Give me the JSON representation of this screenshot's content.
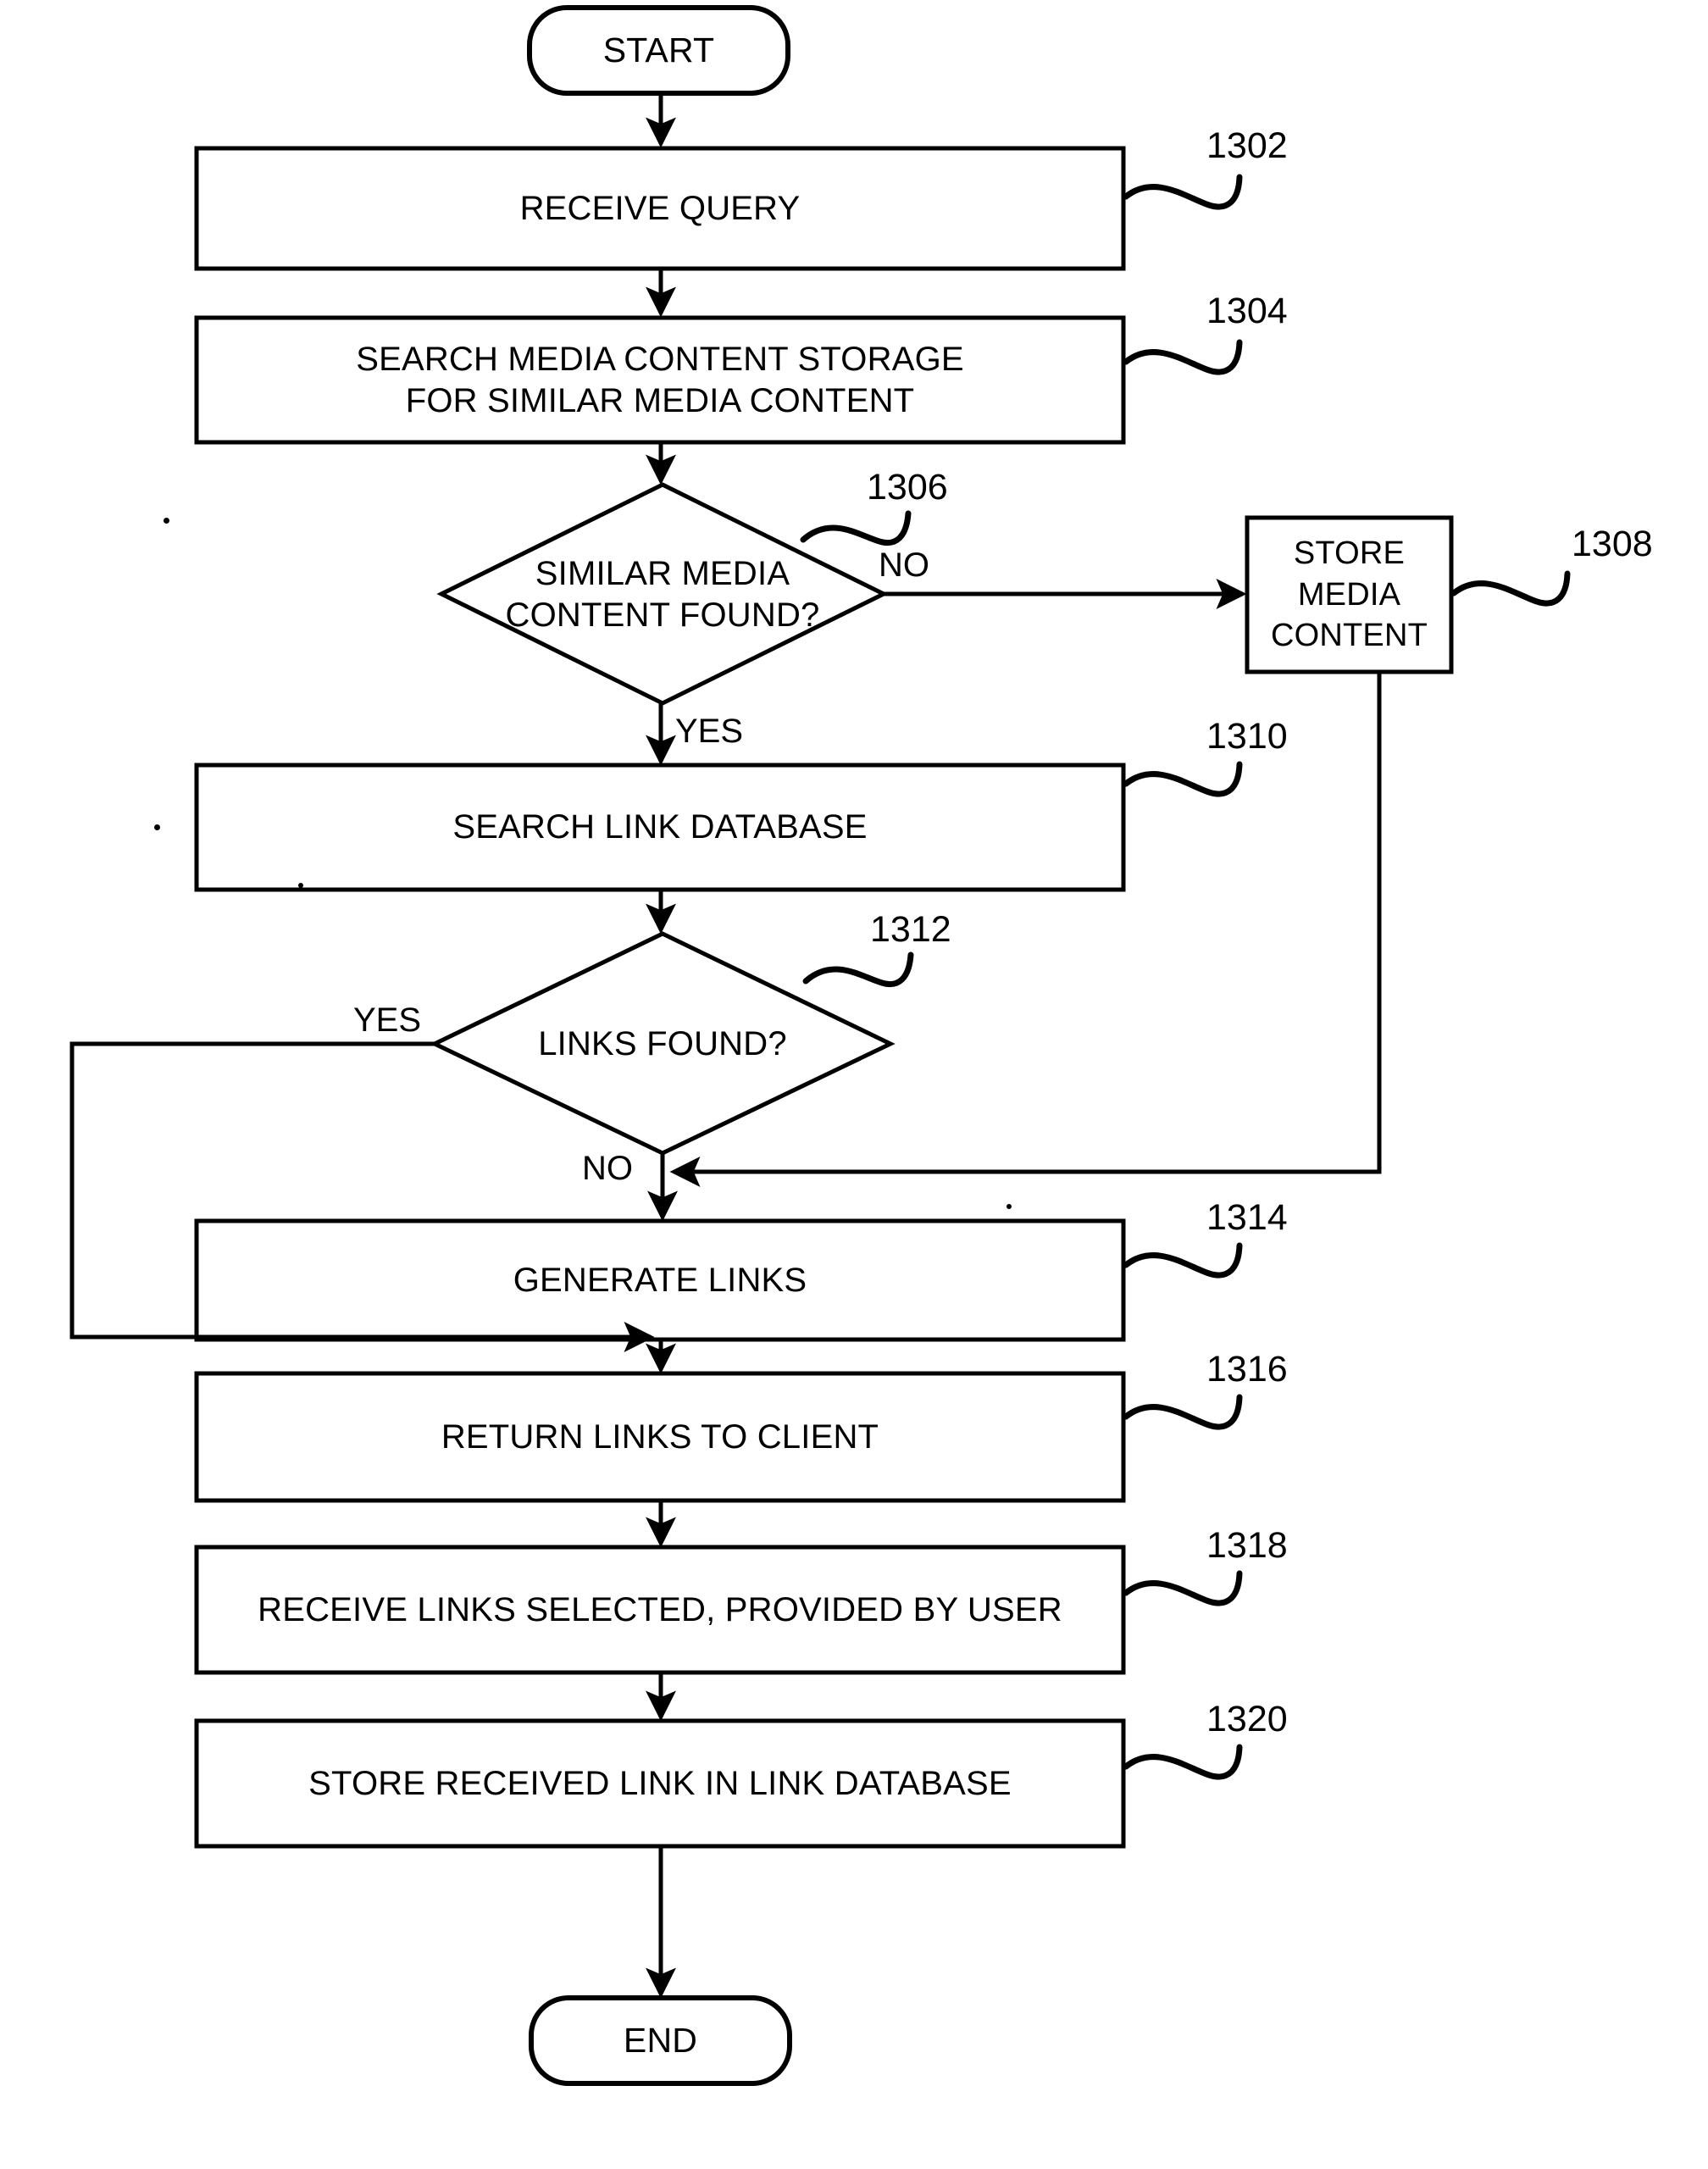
{
  "figure": {
    "type": "flowchart",
    "title": "",
    "terminators": [
      {
        "id": "start",
        "label": "START"
      },
      {
        "id": "end",
        "label": "END"
      }
    ],
    "process_boxes": [
      {
        "id": "1302",
        "ref": "1302",
        "label": "RECEIVE QUERY"
      },
      {
        "id": "1304",
        "ref": "1304",
        "line1": "SEARCH MEDIA CONTENT STORAGE",
        "line2": "FOR SIMILAR MEDIA CONTENT"
      },
      {
        "id": "1308",
        "ref": "1308",
        "line1": "STORE",
        "line2": "MEDIA",
        "line3": "CONTENT"
      },
      {
        "id": "1310",
        "ref": "1310",
        "label": "SEARCH LINK DATABASE"
      },
      {
        "id": "1314",
        "ref": "1314",
        "label": "GENERATE LINKS"
      },
      {
        "id": "1316",
        "ref": "1316",
        "label": "RETURN LINKS TO CLIENT"
      },
      {
        "id": "1318",
        "ref": "1318",
        "label": "RECEIVE LINKS SELECTED, PROVIDED BY USER"
      },
      {
        "id": "1320",
        "ref": "1320",
        "label": "STORE RECEIVED LINK IN LINK DATABASE"
      }
    ],
    "decisions": [
      {
        "id": "1306",
        "ref": "1306",
        "line1": "SIMILAR MEDIA",
        "line2": "CONTENT FOUND?",
        "branch_no": "NO",
        "branch_yes": "YES"
      },
      {
        "id": "1312",
        "ref": "1312",
        "label": "LINKS FOUND?",
        "branch_yes": "YES",
        "branch_no": "NO"
      }
    ],
    "edge_labels": {
      "d1306_no": "NO",
      "d1306_yes": "YES",
      "d1312_yes": "YES",
      "d1312_no": "NO"
    },
    "reference_numerals": [
      "1302",
      "1304",
      "1306",
      "1308",
      "1310",
      "1312",
      "1314",
      "1316",
      "1318",
      "1320"
    ],
    "colors": {
      "stroke": "#000000",
      "background": "#ffffff",
      "text": "#000000"
    }
  }
}
